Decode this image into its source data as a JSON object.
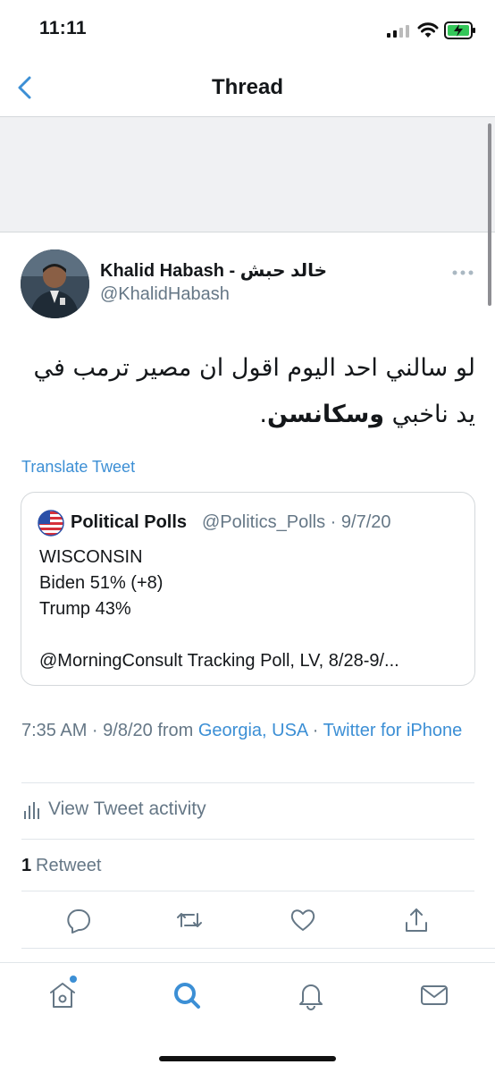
{
  "status_bar": {
    "time": "11:11"
  },
  "nav": {
    "title": "Thread"
  },
  "tweet": {
    "author_name": "Khalid Habash - خالد حبش",
    "author_handle": "@KhalidHabash",
    "text_line1": "لو سالني احد اليوم اقول ان مصير ترمب في",
    "text_line2_plain": "يد ناخبي ",
    "text_line2_bold": "وسكانسن",
    "text_line2_end": ".",
    "translate_label": "Translate Tweet"
  },
  "quote": {
    "name": "Political Polls",
    "handle_date": "@Politics_Polls · 9/7/20",
    "line1": "WISCONSIN",
    "line2": "Biden 51% (+8)",
    "line3": "Trump 43%",
    "line4": "@MorningConsult Tracking Poll, LV, 8/28-9/..."
  },
  "meta": {
    "time_date": "7:35 AM · 9/8/20 from ",
    "location": "Georgia, USA",
    "sep": " · ",
    "client": "Twitter for iPhone"
  },
  "activity": {
    "label": "View Tweet activity"
  },
  "retweets": {
    "count": "1",
    "label": "Retweet"
  },
  "colors": {
    "accent": "#3c8fd5",
    "secondary_text": "#657786",
    "battery": "#34c759"
  },
  "icons": {
    "actions": [
      "reply-icon",
      "retweet-icon",
      "like-icon",
      "share-icon"
    ],
    "tabs": [
      "home-icon",
      "search-icon",
      "notifications-icon",
      "messages-icon"
    ]
  }
}
